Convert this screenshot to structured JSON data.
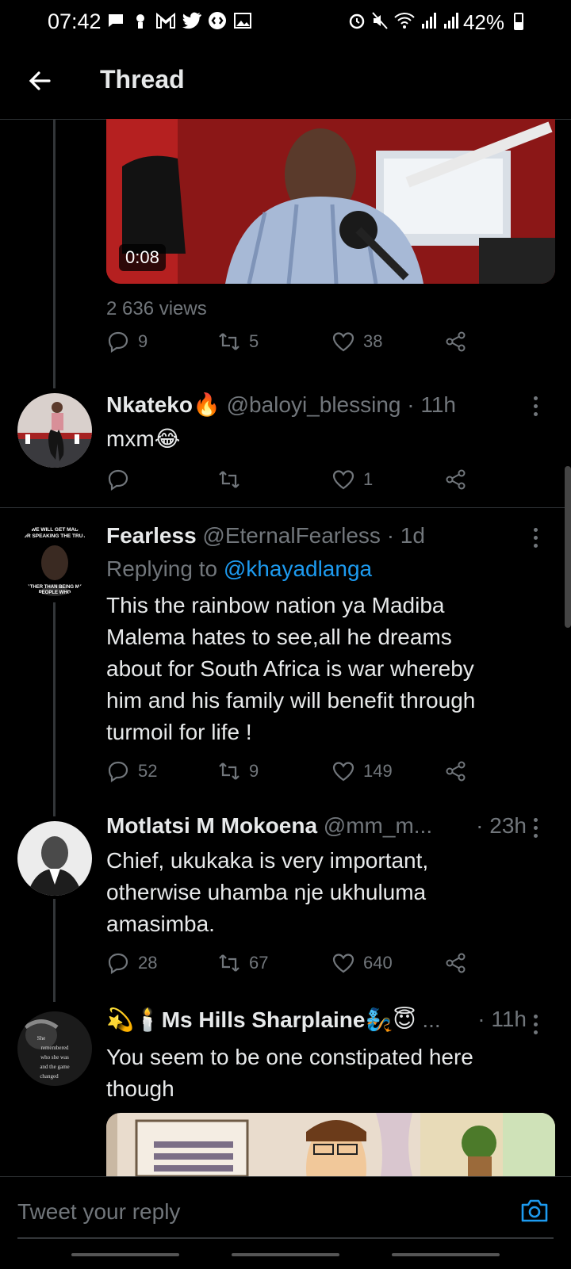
{
  "status": {
    "time": "07:42",
    "battery": "42%",
    "battery_fraction": 0.42
  },
  "appbar": {
    "title": "Thread"
  },
  "video": {
    "duration": "0:08",
    "views": "2 636 views",
    "actions": {
      "replies": "9",
      "retweets": "5",
      "likes": "38"
    }
  },
  "tweets": [
    {
      "name": "Nkateko",
      "name_emoji": "🔥",
      "handle": "@baloyi_blessing · 11h",
      "text": "mxm",
      "text_emoji": "😂",
      "actions": {
        "replies": "",
        "retweets": "",
        "likes": "1"
      }
    },
    {
      "name": "Fearless",
      "handle": "@EternalFearless · 1d",
      "replying_prefix": "Replying to",
      "replying_mention": "@khayadlanga",
      "text_lines": [
        "This the rainbow nation ya Madiba",
        "Malema hates to see,all he dreams",
        "about for South Africa is war whereby",
        "him and his family will benefit through",
        "turmoil for life !"
      ],
      "actions": {
        "replies": "52",
        "retweets": "9",
        "likes": "149"
      }
    },
    {
      "name": "Motlatsi M Mokoena",
      "handle": "@mm_m...",
      "time": "· 23h",
      "text_lines": [
        "Chief, ukukaka is very important,",
        "otherwise uhamba nje ukhuluma",
        "amasimba."
      ],
      "actions": {
        "replies": "28",
        "retweets": "67",
        "likes": "640"
      }
    },
    {
      "name_prefix_emoji": "💫🕯️",
      "name": "Ms Hills Sharplaine",
      "name_suffix_emoji": "🧞😇",
      "ellipsis": "...",
      "time": "· 11h",
      "text_lines": [
        "You seem to be one constipated here",
        "though"
      ]
    }
  ],
  "avatar_texts": {
    "fearless_top": "WE WILL GET MAD FOR SPEAKING THE TRUTH",
    "fearless_bottom": "RATHER THAN BEING MAD PEOPLE WHO",
    "hills": "She remembered who she was and the game changed"
  },
  "composer": {
    "placeholder": "Tweet your reply"
  }
}
